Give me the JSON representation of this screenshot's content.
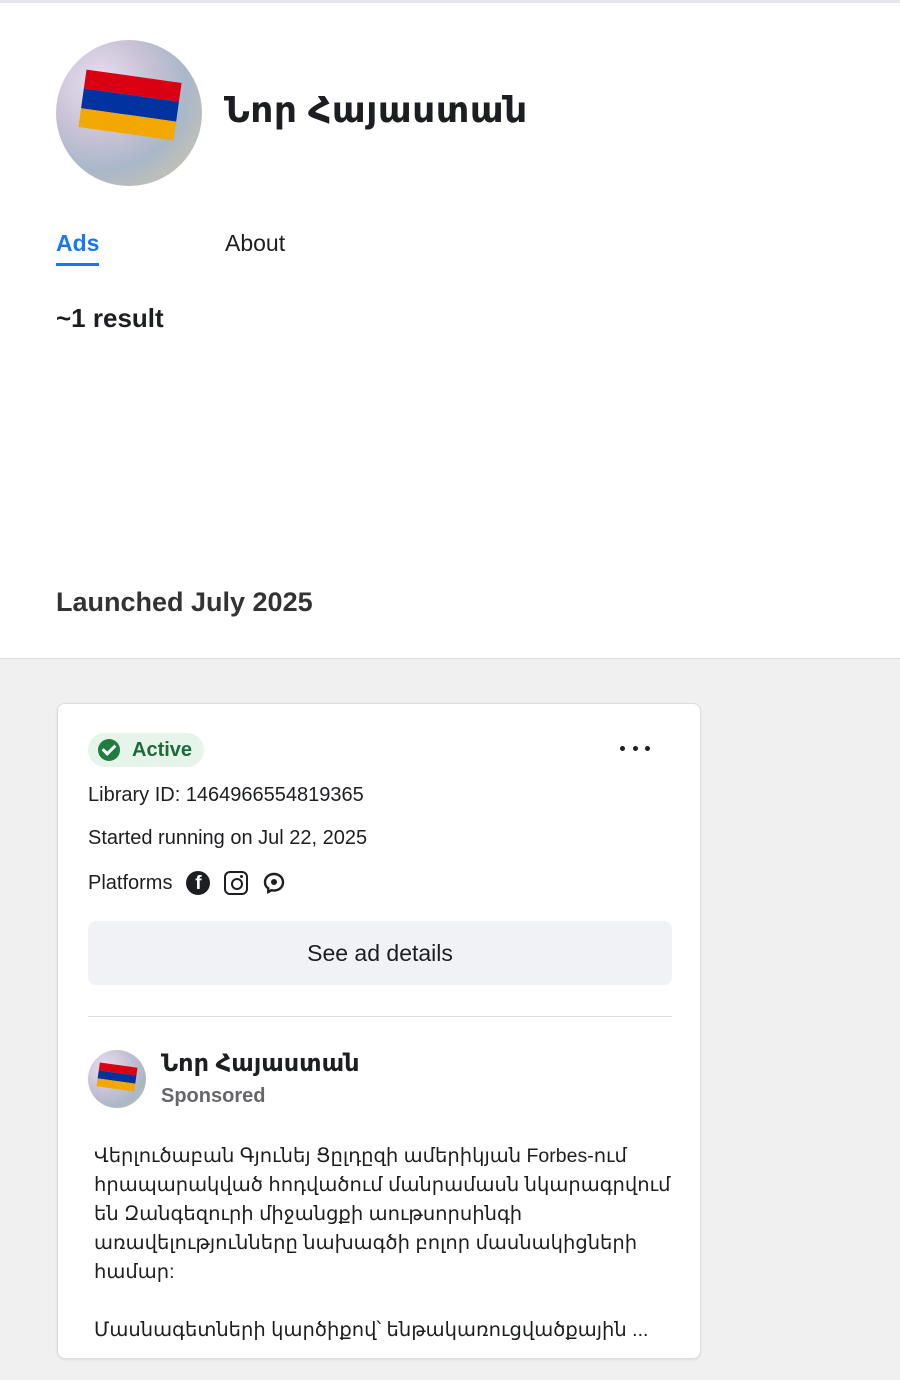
{
  "page": {
    "name": "Նոր Հայաստան",
    "tabs": [
      {
        "label": "Ads",
        "active": true
      },
      {
        "label": "About",
        "active": false
      }
    ],
    "results_text": "~1 result",
    "launched_text": "Launched July 2025"
  },
  "ad_card": {
    "status_label": "Active",
    "library_id": "Library ID: 1464966554819365",
    "started_running": "Started running on Jul 22, 2025",
    "platforms_label": "Platforms",
    "platforms": [
      "facebook-icon",
      "instagram-icon",
      "messenger-icon"
    ],
    "details_button": "See ad details",
    "post": {
      "page_name": "Նոր Հայաստան",
      "sponsored_label": "Sponsored",
      "body": "Վերլուծաբան Գյունեյ Ցըլդըզի ամերիկյան Forbes-ում հրապարակված հոդվածում մանրամասն նկարագրվում են Զանգեզուրի միջանցքի աութսորսինգի առավելությունները նախագծի բոլոր մասնակիցների համար:",
      "body_continued": "Մասնագետների կարծիքով՝ ենթակառուցվածքային ..."
    }
  },
  "colors": {
    "accent": "#1877f2",
    "active_badge_bg": "#e6f4ea",
    "active_badge_text": "#1e6b3a",
    "flag_red": "#d90012",
    "flag_blue": "#0033a0",
    "flag_orange": "#f2a800"
  }
}
